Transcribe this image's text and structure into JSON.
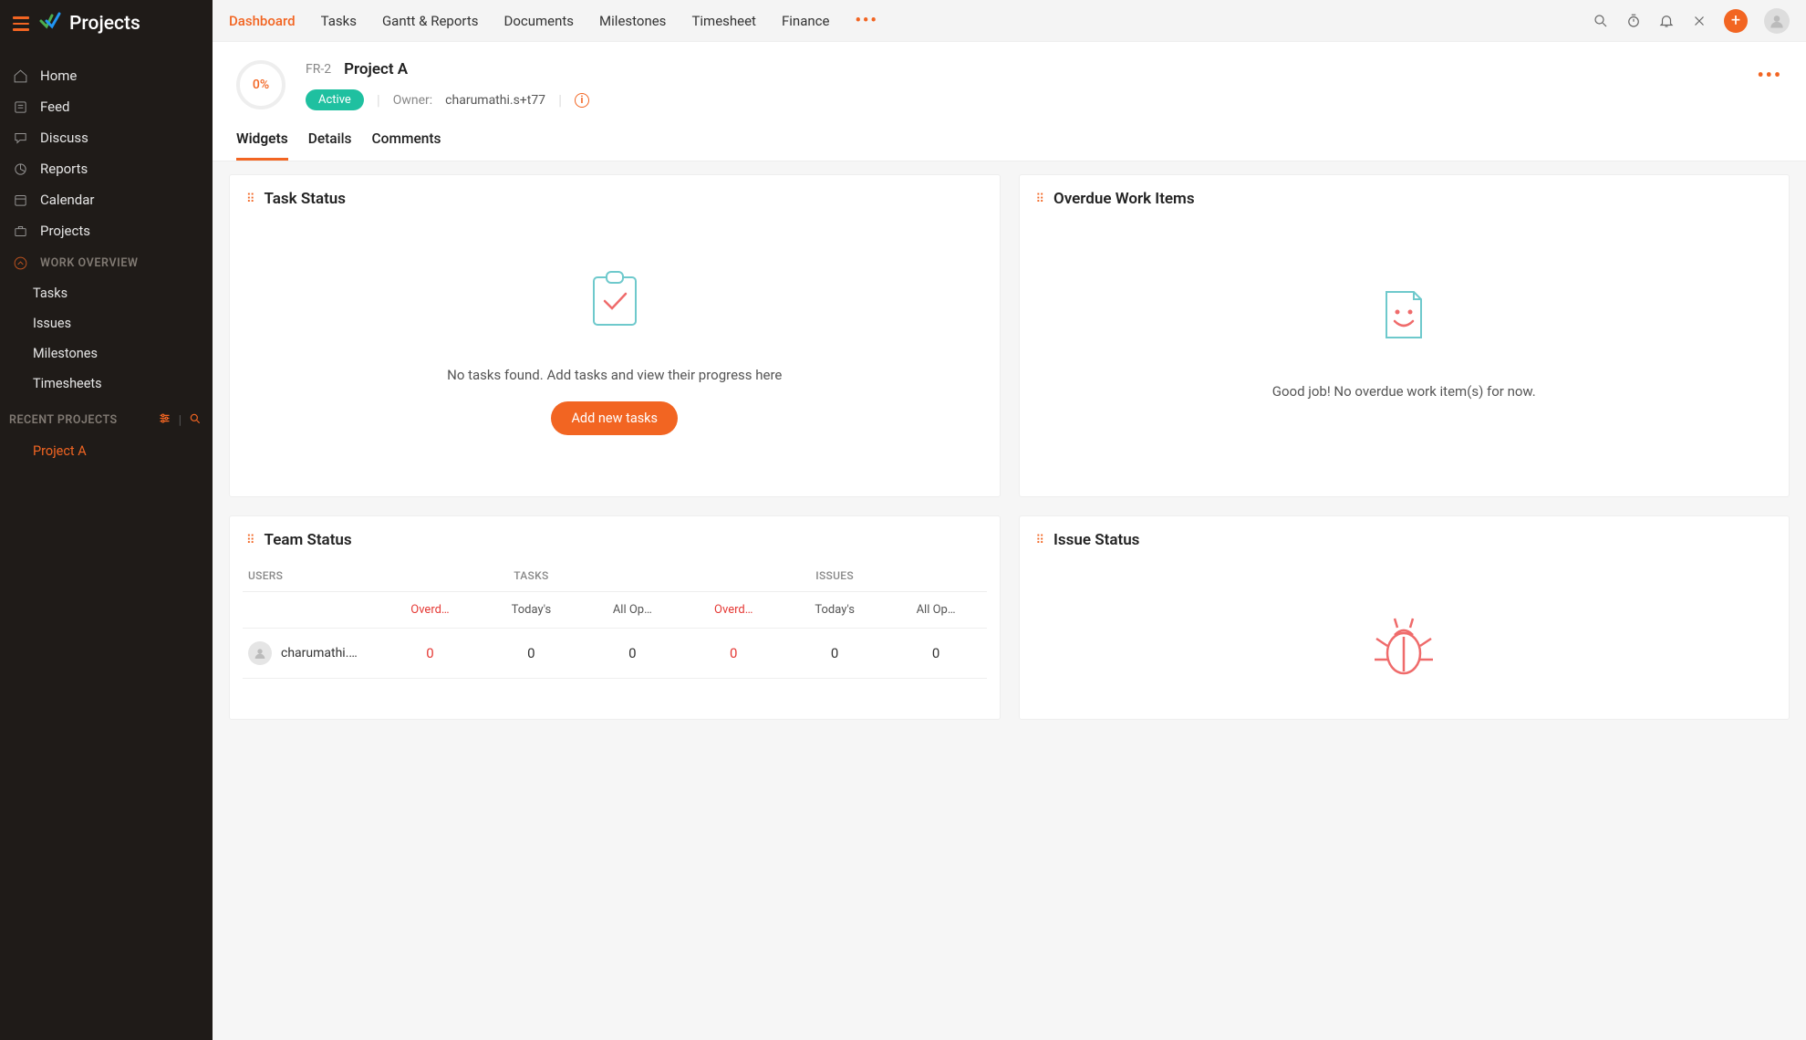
{
  "app": {
    "name": "Projects"
  },
  "sidebar": {
    "nav": [
      {
        "label": "Home"
      },
      {
        "label": "Feed"
      },
      {
        "label": "Discuss"
      },
      {
        "label": "Reports"
      },
      {
        "label": "Calendar"
      },
      {
        "label": "Projects"
      }
    ],
    "work_overview": {
      "title": "WORK OVERVIEW",
      "items": [
        {
          "label": "Tasks"
        },
        {
          "label": "Issues"
        },
        {
          "label": "Milestones"
        },
        {
          "label": "Timesheets"
        }
      ]
    },
    "recent": {
      "title": "RECENT PROJECTS",
      "items": [
        {
          "label": "Project A"
        }
      ]
    }
  },
  "topnav": {
    "items": [
      {
        "label": "Dashboard",
        "active": true
      },
      {
        "label": "Tasks"
      },
      {
        "label": "Gantt & Reports"
      },
      {
        "label": "Documents"
      },
      {
        "label": "Milestones"
      },
      {
        "label": "Timesheet"
      },
      {
        "label": "Finance"
      }
    ]
  },
  "project": {
    "progress": "0%",
    "code": "FR-2",
    "name": "Project A",
    "status": "Active",
    "owner_label": "Owner:",
    "owner_name": "charumathi.s+t77"
  },
  "subtabs": [
    {
      "label": "Widgets",
      "active": true
    },
    {
      "label": "Details"
    },
    {
      "label": "Comments"
    }
  ],
  "widgets": {
    "task_status": {
      "title": "Task Status",
      "empty_text": "No tasks found. Add tasks and view their progress here",
      "button": "Add new tasks"
    },
    "overdue": {
      "title": "Overdue Work Items",
      "empty_text": "Good job! No overdue work item(s) for now."
    },
    "team_status": {
      "title": "Team Status",
      "head_users": "USERS",
      "head_tasks": "TASKS",
      "head_issues": "ISSUES",
      "sub_overdue": "Overd…",
      "sub_today": "Today's",
      "sub_allopen": "All Op…",
      "rows": [
        {
          "user": "charumathi.…",
          "t_over": "0",
          "t_today": "0",
          "t_open": "0",
          "i_over": "0",
          "i_today": "0",
          "i_open": "0"
        }
      ]
    },
    "issue_status": {
      "title": "Issue Status"
    }
  }
}
